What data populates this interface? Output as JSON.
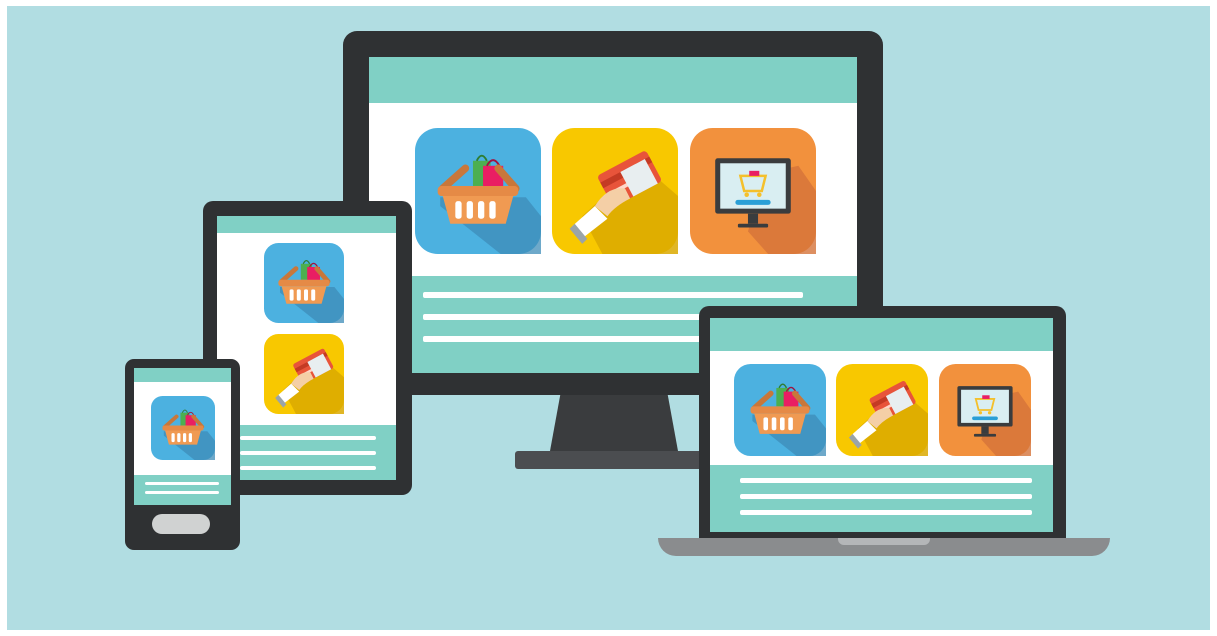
{
  "scene": {
    "background_color": "#b1dde2",
    "accent_teal": "#80d0c5",
    "bezel_color": "#2f3133"
  },
  "devices": [
    "desktop-monitor",
    "tablet",
    "smartphone",
    "laptop"
  ],
  "tiles": [
    {
      "icon": "shopping-basket-icon",
      "color": "#4bb0e0"
    },
    {
      "icon": "credit-card-hand-icon",
      "color": "#f8c800"
    },
    {
      "icon": "online-shop-monitor-icon",
      "color": "#f2913d"
    }
  ]
}
